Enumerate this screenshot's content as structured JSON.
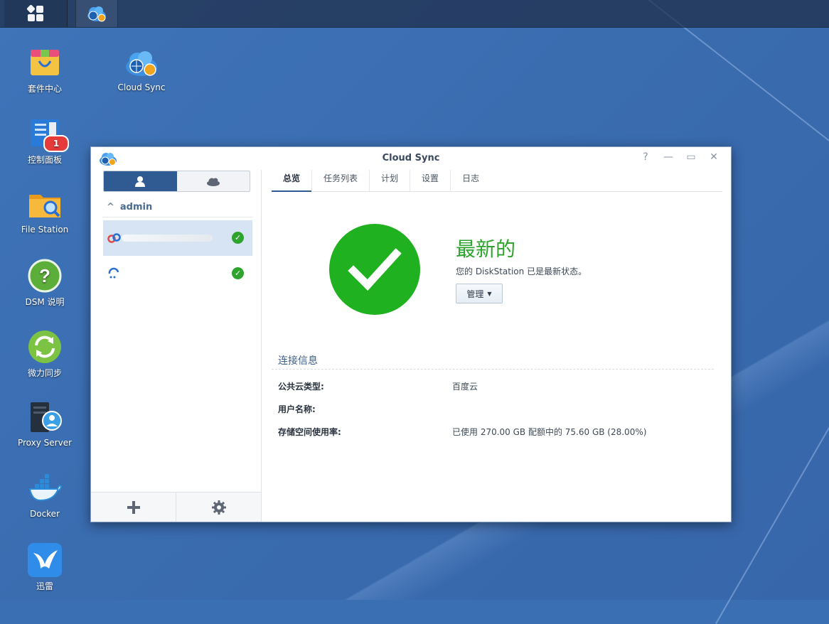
{
  "desktop": {
    "icons": [
      {
        "label": "套件中心"
      },
      {
        "label": "Cloud Sync"
      },
      {
        "label": "控制面板",
        "badge": "1"
      },
      {
        "label": "File Station"
      },
      {
        "label": "DSM 说明"
      },
      {
        "label": "微力同步"
      },
      {
        "label": "Proxy Server"
      },
      {
        "label": "Docker"
      },
      {
        "label": "迅雷"
      }
    ]
  },
  "window": {
    "title": "Cloud Sync",
    "controls": {
      "help": "?",
      "minimize": "—",
      "maximize": "▭",
      "close": "✕"
    },
    "sidebar": {
      "group_label": "admin",
      "connections": [
        {
          "status_icon": "check-icon",
          "selected": true
        },
        {
          "status_icon": "check-icon",
          "selected": false
        }
      ]
    },
    "tabs": [
      "总览",
      "任务列表",
      "计划",
      "设置",
      "日志"
    ],
    "active_tab": "总览",
    "status": {
      "title": "最新的",
      "description": "您的 DiskStation 已是最新状态。",
      "manage_label": "管理"
    },
    "connection_info": {
      "section_title": "连接信息",
      "rows": [
        {
          "key": "公共云类型:",
          "value": "百度云"
        },
        {
          "key": "用户名称:",
          "value": ""
        },
        {
          "key": "存储空间使用率:",
          "value": "已使用 270.00 GB 配额中的 75.60 GB (28.00%)"
        }
      ]
    }
  },
  "colors": {
    "desktop": "#3b6fb3",
    "accent": "#2f5b92",
    "success": "#1fb11f"
  }
}
